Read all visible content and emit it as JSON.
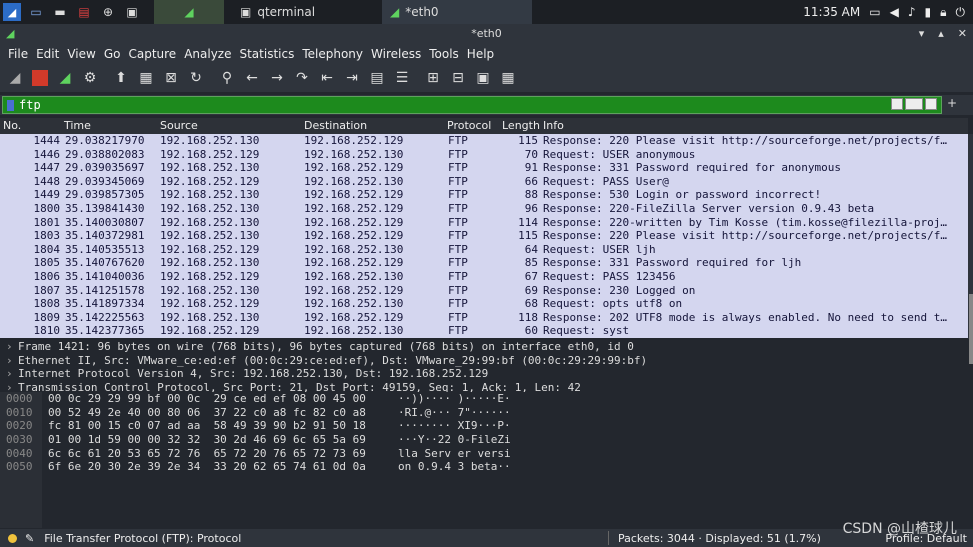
{
  "taskbar": {
    "tasks": [
      {
        "label": "qterminal"
      },
      {
        "label": "*eth0"
      }
    ],
    "clock": "11:35 AM",
    "icons": [
      "kali-menu-icon",
      "desktop-icon",
      "folder-icon",
      "text-editor-icon",
      "browser-icon",
      "terminal-icon"
    ]
  },
  "window": {
    "title": "*eth0"
  },
  "menu": [
    "File",
    "Edit",
    "View",
    "Go",
    "Capture",
    "Analyze",
    "Statistics",
    "Telephony",
    "Wireless",
    "Tools",
    "Help"
  ],
  "filter": {
    "value": "ftp"
  },
  "columns": {
    "no": "No.",
    "time": "Time",
    "src": "Source",
    "dst": "Destination",
    "proto": "Protocol",
    "len": "Length",
    "info": "Info"
  },
  "packets": [
    {
      "no": "1444",
      "time": "29.038217970",
      "src": "192.168.252.130",
      "dst": "192.168.252.129",
      "proto": "FTP",
      "len": "115",
      "info": "Response: 220 Please visit http://sourceforge.net/projects/f…"
    },
    {
      "no": "1446",
      "time": "29.038802083",
      "src": "192.168.252.129",
      "dst": "192.168.252.130",
      "proto": "FTP",
      "len": "70",
      "info": "Request: USER anonymous"
    },
    {
      "no": "1447",
      "time": "29.039035697",
      "src": "192.168.252.130",
      "dst": "192.168.252.129",
      "proto": "FTP",
      "len": "91",
      "info": "Response: 331 Password required for anonymous"
    },
    {
      "no": "1448",
      "time": "29.039345069",
      "src": "192.168.252.129",
      "dst": "192.168.252.130",
      "proto": "FTP",
      "len": "66",
      "info": "Request: PASS User@"
    },
    {
      "no": "1449",
      "time": "29.039857305",
      "src": "192.168.252.130",
      "dst": "192.168.252.129",
      "proto": "FTP",
      "len": "88",
      "info": "Response: 530 Login or password incorrect!"
    },
    {
      "no": "1800",
      "time": "35.139841430",
      "src": "192.168.252.130",
      "dst": "192.168.252.129",
      "proto": "FTP",
      "len": "96",
      "info": "Response: 220-FileZilla Server version 0.9.43 beta"
    },
    {
      "no": "1801",
      "time": "35.140030807",
      "src": "192.168.252.130",
      "dst": "192.168.252.129",
      "proto": "FTP",
      "len": "114",
      "info": "Response: 220-written by Tim Kosse (tim.kosse@filezilla-proj…"
    },
    {
      "no": "1803",
      "time": "35.140372981",
      "src": "192.168.252.130",
      "dst": "192.168.252.129",
      "proto": "FTP",
      "len": "115",
      "info": "Response: 220 Please visit http://sourceforge.net/projects/f…"
    },
    {
      "no": "1804",
      "time": "35.140535513",
      "src": "192.168.252.129",
      "dst": "192.168.252.130",
      "proto": "FTP",
      "len": "64",
      "info": "Request: USER ljh"
    },
    {
      "no": "1805",
      "time": "35.140767620",
      "src": "192.168.252.130",
      "dst": "192.168.252.129",
      "proto": "FTP",
      "len": "85",
      "info": "Response: 331 Password required for ljh"
    },
    {
      "no": "1806",
      "time": "35.141040036",
      "src": "192.168.252.129",
      "dst": "192.168.252.130",
      "proto": "FTP",
      "len": "67",
      "info": "Request: PASS 123456"
    },
    {
      "no": "1807",
      "time": "35.141251578",
      "src": "192.168.252.130",
      "dst": "192.168.252.129",
      "proto": "FTP",
      "len": "69",
      "info": "Response: 230 Logged on"
    },
    {
      "no": "1808",
      "time": "35.141897334",
      "src": "192.168.252.129",
      "dst": "192.168.252.130",
      "proto": "FTP",
      "len": "68",
      "info": "Request: opts utf8 on"
    },
    {
      "no": "1809",
      "time": "35.142225563",
      "src": "192.168.252.130",
      "dst": "192.168.252.129",
      "proto": "FTP",
      "len": "118",
      "info": "Response: 202 UTF8 mode is always enabled. No need to send t…"
    },
    {
      "no": "1810",
      "time": "35.142377365",
      "src": "192.168.252.129",
      "dst": "192.168.252.130",
      "proto": "FTP",
      "len": "60",
      "info": "Request: syst"
    }
  ],
  "details": [
    "Frame 1421: 96 bytes on wire (768 bits), 96 bytes captured (768 bits) on interface eth0, id 0",
    "Ethernet II, Src: VMware_ce:ed:ef (00:0c:29:ce:ed:ef), Dst: VMware_29:99:bf (00:0c:29:29:99:bf)",
    "Internet Protocol Version 4, Src: 192.168.252.130, Dst: 192.168.252.129",
    "Transmission Control Protocol, Src Port: 21, Dst Port: 49159, Seq: 1, Ack: 1, Len: 42"
  ],
  "hex": [
    {
      "off": "0000",
      "bytes": "00 0c 29 29 99 bf 00 0c  29 ce ed ef 08 00 45 00",
      "ascii": "··))···· )·····E·"
    },
    {
      "off": "0010",
      "bytes": "00 52 49 2e 40 00 80 06  37 22 c0 a8 fc 82 c0 a8",
      "ascii": "·RI.@··· 7\"······"
    },
    {
      "off": "0020",
      "bytes": "fc 81 00 15 c0 07 ad aa  58 49 39 90 b2 91 50 18",
      "ascii": "········ XI9···P·"
    },
    {
      "off": "0030",
      "bytes": "01 00 1d 59 00 00 32 32  30 2d 46 69 6c 65 5a 69",
      "ascii": "···Y··22 0-FileZi"
    },
    {
      "off": "0040",
      "bytes": "6c 6c 61 20 53 65 72 76  65 72 20 76 65 72 73 69",
      "ascii": "lla Serv er versi"
    },
    {
      "off": "0050",
      "bytes": "6f 6e 20 30 2e 39 2e 34  33 20 62 65 74 61 0d 0a",
      "ascii": "on 0.9.4 3 beta··"
    }
  ],
  "status": {
    "left": "File Transfer Protocol (FTP): Protocol",
    "packets": "Packets: 3044 · Displayed: 51 (1.7%)",
    "profile": "Profile: Default"
  },
  "watermark": "CSDN @山楂球儿",
  "colors": {
    "packet_bg": "#d4d6ef",
    "filter_bg": "#1d8a1d",
    "dark_bg": "#23272e",
    "stop_red": "#d23a2a"
  }
}
